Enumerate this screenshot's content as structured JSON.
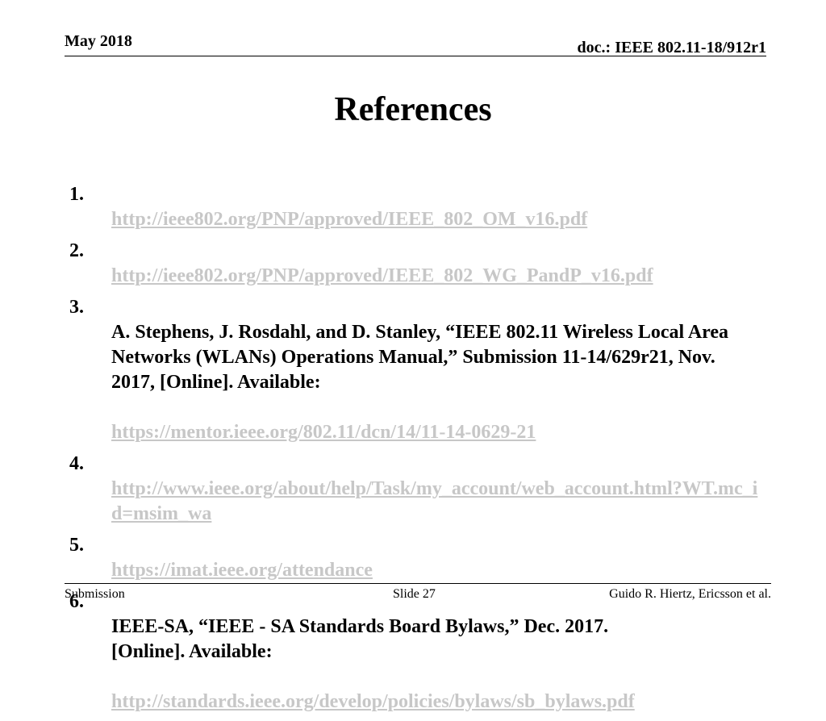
{
  "header": {
    "date": "May 2018",
    "doc_id": "doc.: IEEE 802.11-18/912r1"
  },
  "slide": {
    "title": "References"
  },
  "references": [
    {
      "num": "1.",
      "link": "http://ieee802.org/PNP/approved/IEEE_802_OM_v16.pdf"
    },
    {
      "num": "2.",
      "link": "http://ieee802.org/PNP/approved/IEEE_802_WG_PandP_v16.pdf"
    },
    {
      "num": "3.",
      "text": "A. Stephens, J. Rosdahl, and D. Stanley, “IEEE 802.11 Wireless Local Area Networks (WLANs) Operations Manual,” Submission 11-14/629r21, Nov. 2017, [Online]. Available:",
      "link": "https://mentor.ieee.org/802.11/dcn/14/11-14-0629-21"
    },
    {
      "num": "4.",
      "link": "http://www.ieee.org/about/help/Task/my_account/web_account.html?WT.mc_id=msim_wa"
    },
    {
      "num": "5.",
      "link": "https://imat.ieee.org/attendance"
    },
    {
      "num": "6.",
      "text": "IEEE-SA, “IEEE - SA Standards Board Bylaws,” Dec. 2017.\n[Online]. Available:",
      "link": "http://standards.ieee.org/develop/policies/bylaws/sb_bylaws.pdf"
    }
  ],
  "footer": {
    "left": "Submission",
    "center": "Slide 27",
    "right": "Guido R. Hiertz, Ericsson et al."
  },
  "colors": {
    "link": "#c7c7c7",
    "text": "#000000"
  }
}
